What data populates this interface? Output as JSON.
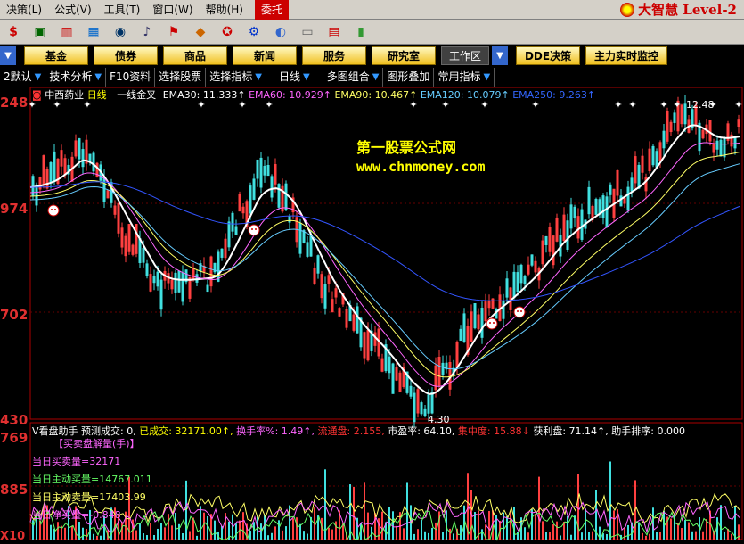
{
  "menu": {
    "items": [
      "决策(L)",
      "公式(V)",
      "工具(T)",
      "窗口(W)",
      "帮助(H)"
    ],
    "active_item": "委托",
    "brand_text": "大智慧 Level-2"
  },
  "toolbar": {
    "icons": [
      "dollar-icon",
      "monitor-icon",
      "chart-icon",
      "grid-icon",
      "binoculars-icon",
      "bell-icon",
      "flag-icon",
      "diamond-icon",
      "stamp-icon",
      "gear-icon",
      "globe-icon",
      "window-icon",
      "panel-icon",
      "bars-icon"
    ]
  },
  "quickbar": {
    "buttons": [
      "基金",
      "债券",
      "商品",
      "新闻",
      "服务",
      "研究室"
    ],
    "workspace_label": "工作区",
    "dde_button": "DDE决策",
    "main_monitor_button": "主力实时监控"
  },
  "tabs": {
    "items": [
      "2默认",
      "技术分析",
      "F10资料",
      "选择股票",
      "选择指标",
      "日线",
      "多图组合",
      "图形叠加",
      "常用指标"
    ]
  },
  "chart_header": {
    "stock_name": "中西药业",
    "period": "日线",
    "indicator": "一线金叉",
    "ema30": "EMA30: 11.333↑",
    "ema60": "EMA60: 10.929↑",
    "ema90": "EMA90: 10.467↑",
    "ema120": "EMA120: 10.079↑",
    "ema250": "EMA250: 9.263↑"
  },
  "price_axis": {
    "p1": "248",
    "p2": "974",
    "p3": "702",
    "p4": "430",
    "high_label": "12.48",
    "low_label": "4.30"
  },
  "watermark": {
    "line1": "第一股票公式网",
    "line2": "www.chnmoney.com"
  },
  "sub_header": {
    "name": "V看盘助手",
    "predict": "预测成交: 0,",
    "done": "已成交: 32171.00↑,",
    "turnover": "换手率%: 1.49↑,",
    "float": "流通盘: 2.155,",
    "pe": "市盈率: 64.10,",
    "concentration": "集中度: 15.88↓",
    "profit": "获利盘: 71.14↑,",
    "rank": "助手排序: 0.000"
  },
  "sub_axis": {
    "s1": "769",
    "s2": "885",
    "s3": "X10"
  },
  "sub_lines": {
    "title": "【买卖盘解量(手)】",
    "buy": "当日买卖量=32171",
    "active_buy": "当日主动买量=14767.011",
    "active_sell": "当日主动卖量=17403.99",
    "net": "当日净买量=-0.848"
  },
  "colors": {
    "accent": "#cc0000",
    "ema30": "#ffffff",
    "ema60": "#ff66ff",
    "ema90": "#ffff66",
    "ema120": "#66ccff",
    "ema250": "#3355ff"
  }
}
